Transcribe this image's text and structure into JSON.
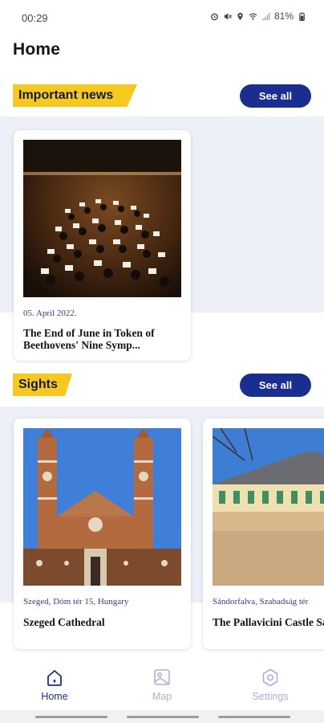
{
  "status_bar": {
    "time": "00:29",
    "battery": "81%"
  },
  "header": {
    "title": "Home"
  },
  "news_section": {
    "label": "Important news",
    "see_all": "See all",
    "cards": [
      {
        "date": "05. April 2022.",
        "title": "The End of June in Token of Beethovens' Nine Symp..."
      }
    ]
  },
  "sights_section": {
    "label": "Sights",
    "see_all": "See all",
    "cards": [
      {
        "location": "Szeged, Dóm tér 15, Hungary",
        "title": "Szeged Cathedral"
      },
      {
        "location": "Sándorfalva, Szabadság tér",
        "title": "The Pallavicini Castle Sándorfalva"
      }
    ]
  },
  "bottom_nav": {
    "items": [
      {
        "label": "Home",
        "icon": "home-icon",
        "active": true
      },
      {
        "label": "Map",
        "icon": "map-icon",
        "active": false
      },
      {
        "label": "Settings",
        "icon": "settings-icon",
        "active": false
      }
    ]
  },
  "colors": {
    "accent_yellow": "#f7c81e",
    "primary_blue": "#1a2e8f",
    "band_bg": "#eef0f8",
    "inactive_nav": "#a9b0d2"
  }
}
